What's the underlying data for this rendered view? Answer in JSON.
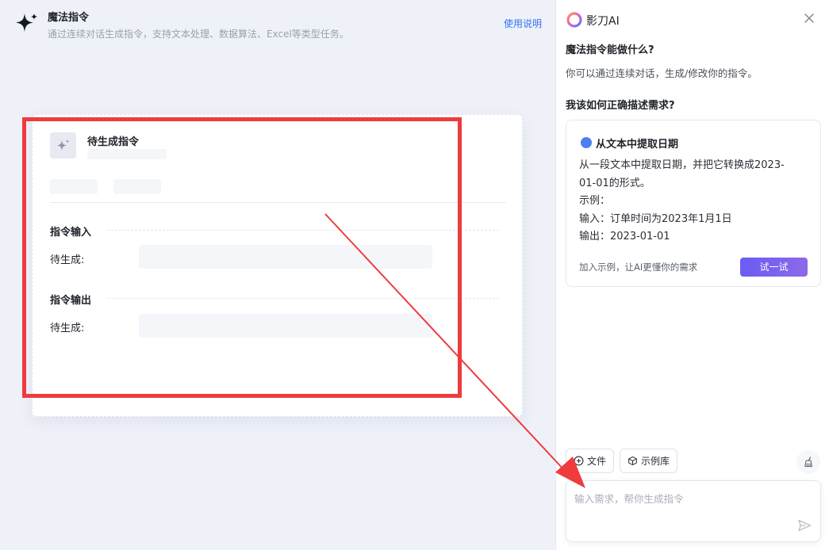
{
  "header": {
    "title": "魔法指令",
    "subtitle": "通过连续对话生成指令，支持文本处理、数据算法、Excel等类型任务。",
    "help_link": "使用说明"
  },
  "preview_card": {
    "title": "待生成指令",
    "input_section": {
      "title": "指令输入",
      "field_label": "待生成:"
    },
    "output_section": {
      "title": "指令输出",
      "field_label": "待生成:"
    }
  },
  "panel": {
    "brand": "影刀AI",
    "question1": "魔法指令能做什么?",
    "answer1": "你可以通过连续对话，生成/修改你的指令。",
    "question2": "我该如何正确描述需求?",
    "example": {
      "title": "从文本中提取日期",
      "lines": [
        "从一段文本中提取日期，并把它转换成2023-",
        "01-01的形式。",
        "示例：",
        "输入：订单时间为2023年1月1日",
        "输出：2023-01-01"
      ],
      "hint": "加入示例，让AI更懂你的需求",
      "try_button": "试一试"
    },
    "chips": {
      "file": "文件",
      "examples": "示例库"
    },
    "input": {
      "placeholder": "输入需求，帮你生成指令"
    }
  },
  "colors": {
    "accent": "#3570f0",
    "annotation_red": "#ef3b3d",
    "try_gradient_start": "#6a5cf5",
    "try_gradient_end": "#8d69e8"
  }
}
